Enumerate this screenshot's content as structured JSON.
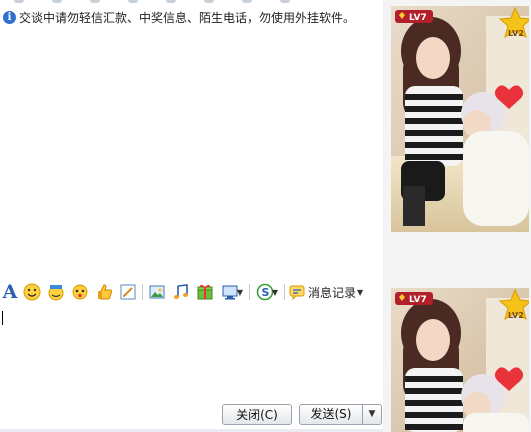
{
  "chat": {
    "notice": "交谈中请勿轻信汇款、中奖信息、陌生电话，勿使用外挂软件。"
  },
  "avatar": {
    "top_level_badge": "LV7",
    "top_rank_badge": "LV2",
    "bottom_level_badge": "LV7",
    "bottom_rank_badge": "LV2"
  },
  "toolbar": {
    "font_label": "A",
    "message_record_label": "消息记录",
    "icons": [
      "font-icon",
      "emoji-icon",
      "magic-face-icon",
      "shake-window-icon",
      "thumbs-up-icon",
      "doodle-icon",
      "image-icon",
      "music-icon",
      "gift-icon",
      "screenshot-icon",
      "search-icon",
      "message-record-icon"
    ]
  },
  "input": {
    "value": ""
  },
  "buttons": {
    "close_label": "关闭(C)",
    "send_label": "发送(S)",
    "send_options_label": "▼"
  },
  "colors": {
    "accent_blue": "#2a5db0",
    "button_border": "#9aa3ad",
    "avatar_column_bg": "#f4f4f4"
  }
}
